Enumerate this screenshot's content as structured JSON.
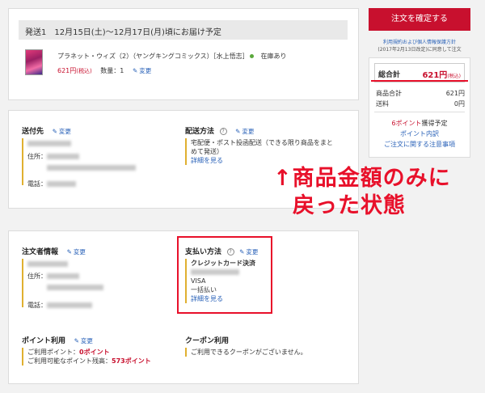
{
  "shipment": {
    "title": "発送1　12月15日(土)〜12月17日(月)頃にお届け予定",
    "product": "プラネット・ウィズ（2）（ヤングキングコミックス）［水上悟志］",
    "stock": "在庫あり",
    "price": "621円",
    "tax_label": "(税込)",
    "qty": "数量：1",
    "edit": "変更"
  },
  "delivery": {
    "dest_title": "送付先",
    "edit": "変更",
    "address_label": "住所：",
    "phone_label": "電話：",
    "method_title": "配送方法",
    "method_value": "宅配便・ポスト投函配送（できる限り商品をまとめて発送）",
    "detail_link": "詳細を見る"
  },
  "order": {
    "info_title": "注文者情報",
    "edit": "変更",
    "address_label": "住所：",
    "phone_label": "電話：",
    "payment_title": "支払い方法",
    "payment_method": "クレジットカード決済",
    "card": "VISA",
    "installments": "一括払い",
    "detail_link": "詳細を見る",
    "points_title": "ポイント利用",
    "points_used_label": "ご利用ポイント：",
    "points_used_value": "0ポイント",
    "points_avail_label": "ご利用可能なポイント残高：",
    "points_avail_value": "573ポイント",
    "coupon_title": "クーポン利用",
    "coupon_msg": "ご利用できるクーポンがございません。"
  },
  "sidebar": {
    "confirm_button": "注文を確定する",
    "terms_line1": "利用規約および個人情報保護方針",
    "terms_line2": "(2017年2月13日改定)に同意して注文",
    "total_label": "総合計",
    "total_value": "621円",
    "total_tax": "(税込)",
    "subtotal_label": "商品合計",
    "subtotal_value": "621円",
    "shipping_label": "送料",
    "shipping_value": "0円",
    "points_earned": "6ポイント",
    "points_earned_suffix": "獲得予定",
    "points_detail_link": "ポイント内訳",
    "notes_link": "ご注文に関する注意事項"
  },
  "annotation": {
    "line1": "↑商品金額のみに",
    "line2": "戻った状態"
  },
  "colors": {
    "accent": "#c8102e",
    "annotation": "#e8102a",
    "link": "#2a62b8",
    "stock_dot": "#5aa83c"
  }
}
